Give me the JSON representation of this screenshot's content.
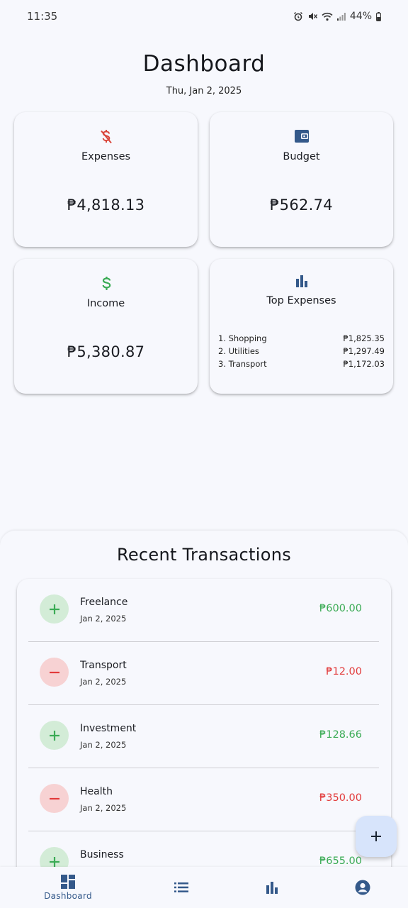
{
  "status_bar": {
    "time": "11:35",
    "battery": "44%"
  },
  "header": {
    "title": "Dashboard",
    "date": "Thu, Jan 2, 2025"
  },
  "cards": {
    "expenses": {
      "label": "Expenses",
      "value": "₱4,818.13",
      "icon": "money-off-icon",
      "color": "#d9463b"
    },
    "budget": {
      "label": "Budget",
      "value": "₱562.74",
      "icon": "wallet-icon",
      "color": "#34598a"
    },
    "income": {
      "label": "Income",
      "value": "₱5,380.87",
      "icon": "dollar-icon",
      "color": "#3bab55"
    },
    "top_expenses": {
      "label": "Top Expenses",
      "icon": "bar-chart-icon",
      "items": [
        {
          "name": "1. Shopping",
          "amount": "₱1,825.35"
        },
        {
          "name": "2. Utilities",
          "amount": "₱1,297.49"
        },
        {
          "name": "3. Transport",
          "amount": "₱1,172.03"
        }
      ]
    }
  },
  "recent": {
    "title": "Recent Transactions",
    "transactions": [
      {
        "name": "Freelance",
        "date": "Jan 2, 2025",
        "amount": "₱600.00",
        "type": "income"
      },
      {
        "name": "Transport",
        "date": "Jan 2, 2025",
        "amount": "₱12.00",
        "type": "expense"
      },
      {
        "name": "Investment",
        "date": "Jan 2, 2025",
        "amount": "₱128.66",
        "type": "income"
      },
      {
        "name": "Health",
        "date": "Jan 2, 2025",
        "amount": "₱350.00",
        "type": "expense"
      },
      {
        "name": "Business",
        "date": "",
        "amount": "₱655.00",
        "type": "income"
      }
    ]
  },
  "nav": {
    "items": [
      {
        "label": "Dashboard",
        "icon": "dashboard-icon",
        "active": true
      },
      {
        "label": "",
        "icon": "list-icon",
        "active": false
      },
      {
        "label": "",
        "icon": "bar-chart-icon",
        "active": false
      },
      {
        "label": "",
        "icon": "account-circle-icon",
        "active": false
      }
    ]
  },
  "colors": {
    "accent": "#34598a",
    "income": "#3bab55",
    "expense": "#e23b3b",
    "fab_bg": "#d7e4fb"
  }
}
